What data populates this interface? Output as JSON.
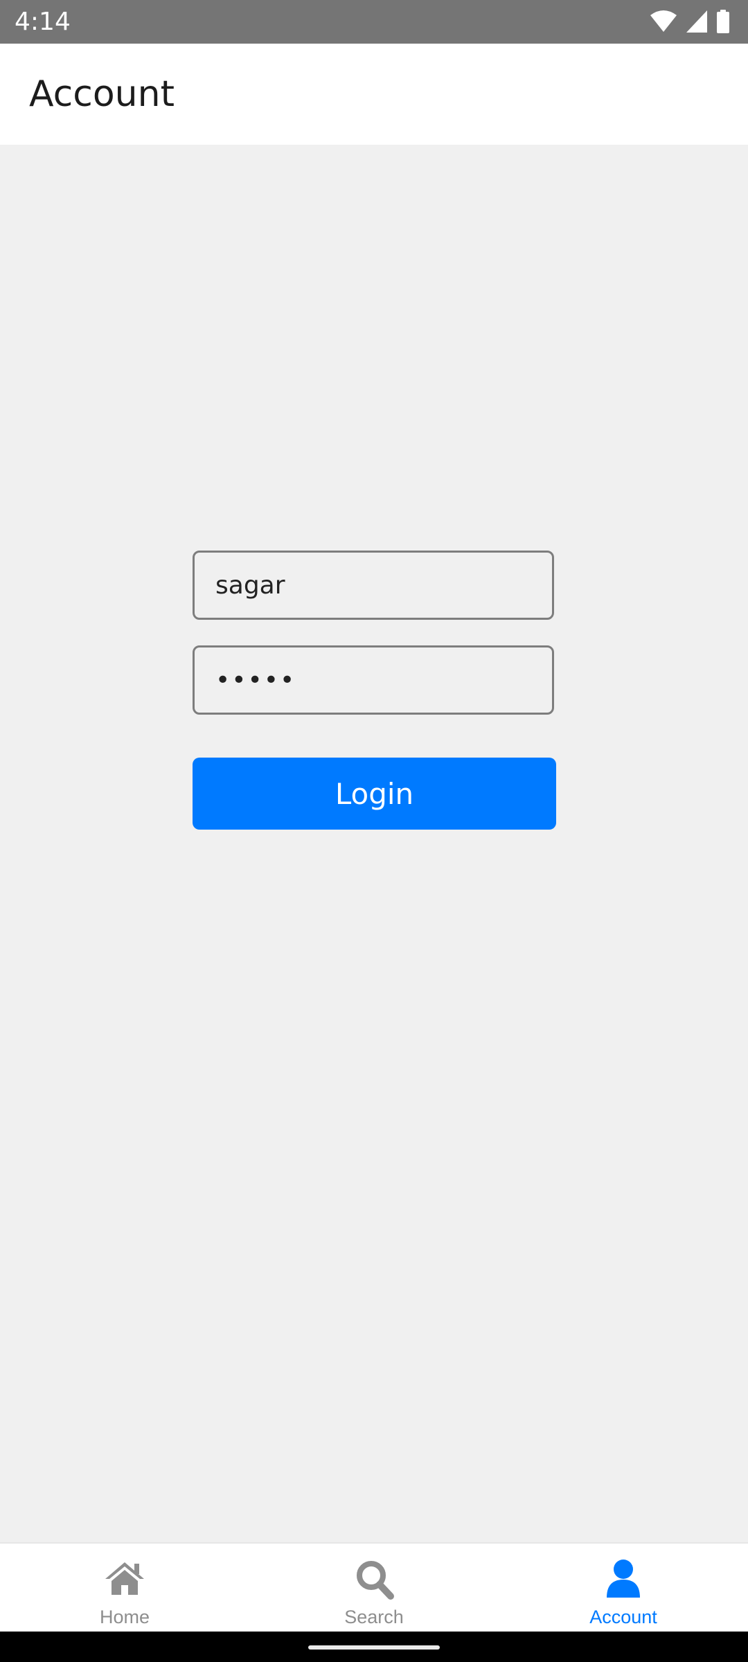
{
  "status_bar": {
    "time": "4:14",
    "icons": [
      "wifi-icon",
      "cell-signal-icon",
      "battery-icon"
    ]
  },
  "header": {
    "title": "Account"
  },
  "login_form": {
    "username_value": "sagar",
    "password_value": "•••••",
    "login_label": "Login"
  },
  "tabs": [
    {
      "label": "Home",
      "icon": "home-icon",
      "active": false
    },
    {
      "label": "Search",
      "icon": "search-icon",
      "active": false
    },
    {
      "label": "Account",
      "icon": "user-icon",
      "active": true
    }
  ],
  "colors": {
    "accent": "#007aff",
    "inactive": "#8e8e8e",
    "status_bar": "#757575",
    "background": "#f0f0f0"
  }
}
